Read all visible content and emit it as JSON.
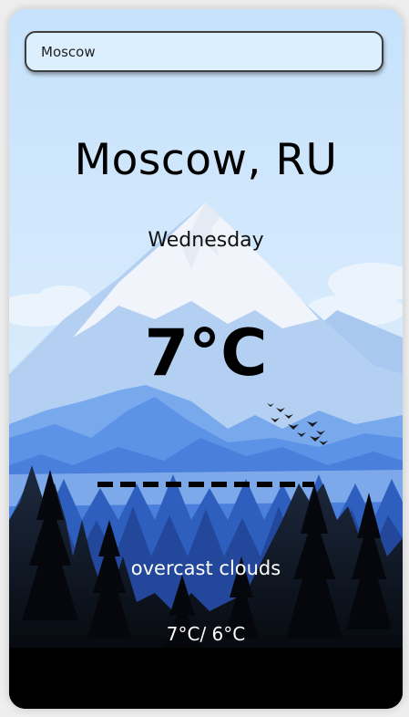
{
  "search": {
    "value": "Moscow"
  },
  "weather": {
    "location": "Moscow, RU",
    "day": "Wednesday",
    "temperature": "7°C",
    "description": "overcast clouds",
    "min_max": "7°C/ 6°C"
  },
  "icons": {
    "background": "mountain-forest-illustration",
    "birds": "bird-flock-icon"
  },
  "colors": {
    "sky": "#cfe6fb",
    "mountain_snow": "#eef3fa",
    "mountain_blue": "#7fb1ee",
    "forest_dark": "#0b1017",
    "text_dark": "#000000",
    "text_light": "#ffffff"
  }
}
